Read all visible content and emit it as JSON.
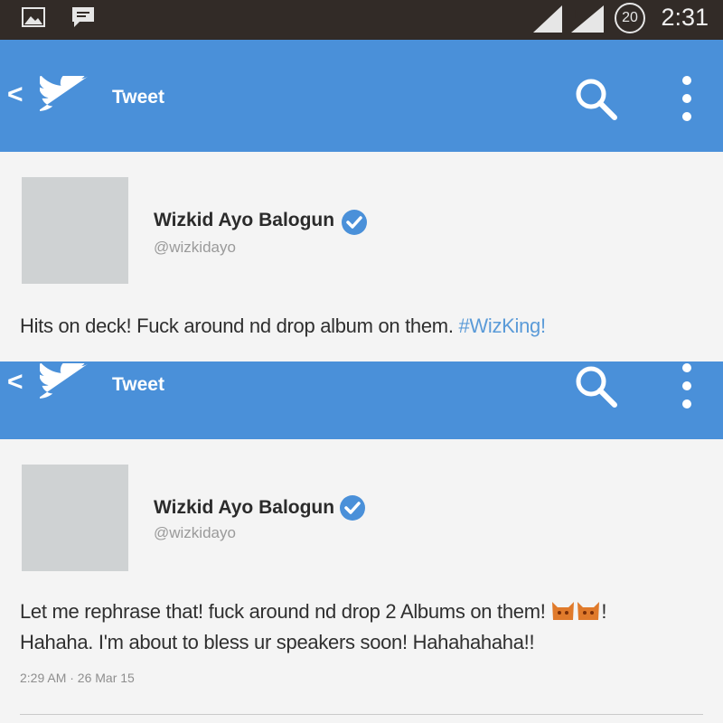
{
  "status_bar": {
    "time": "2:31",
    "notification_badge": "20",
    "icons": [
      "gallery-icon",
      "message-icon",
      "signal-icon",
      "signal-e-icon"
    ]
  },
  "screens": [
    {
      "app_bar": {
        "title": "Tweet",
        "back": "<"
      },
      "tweet": {
        "author_name": "Wizkid Ayo Balogun",
        "handle": "@wizkidayo",
        "text": "Hits on deck! Fuck around nd drop album on them. ",
        "hashtag": "#WizKing!"
      }
    },
    {
      "app_bar": {
        "title": "Tweet",
        "back": "<"
      },
      "tweet": {
        "author_name": "Wizkid Ayo Balogun",
        "handle": "@wizkidayo",
        "text_line1": "Let me rephrase that! fuck around nd drop 2 Albums on them!",
        "text_line1_end": "!",
        "text_line2": "Hahaha. I'm about to bless ur speakers soon! Hahahahaha!!",
        "timestamp": "2:29 AM · 26 Mar 15"
      }
    }
  ],
  "colors": {
    "app_bar": "#4a90d9",
    "status_bar": "#322b27",
    "hashtag": "#5b9bd8",
    "verified": "#4a90d9"
  }
}
